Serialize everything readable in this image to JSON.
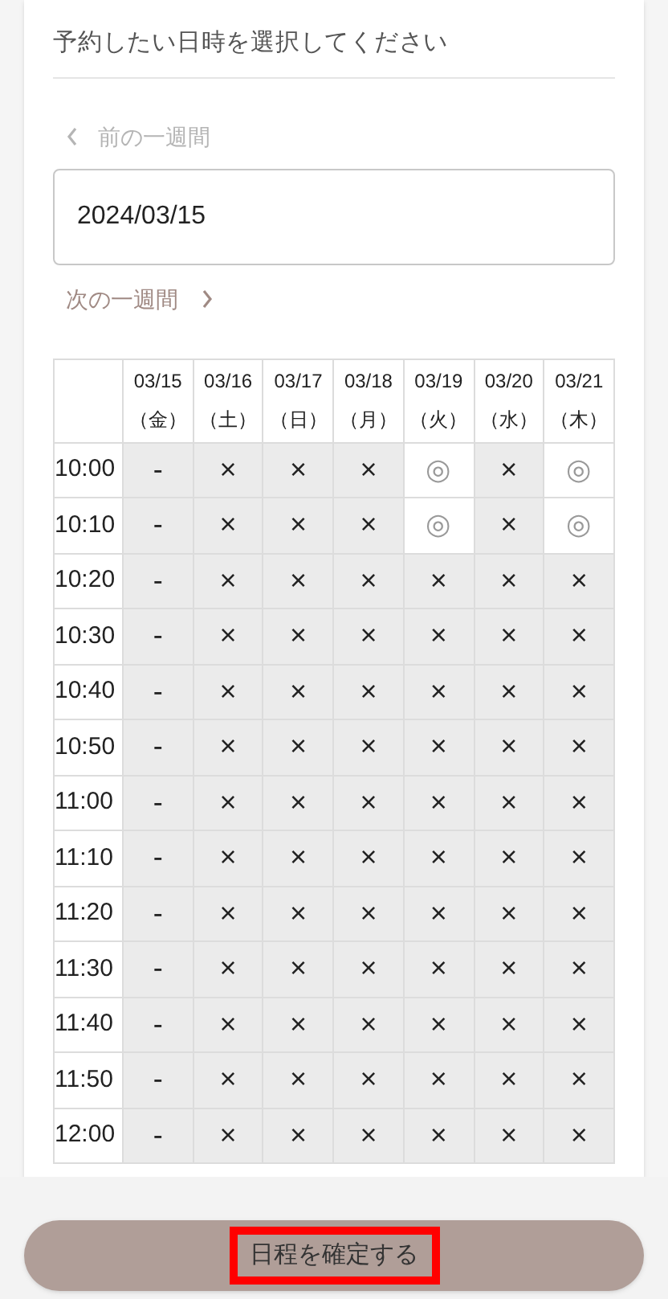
{
  "heading": "予約したい日時を選択してください",
  "prev_week": {
    "label": "前の一週間",
    "disabled": true
  },
  "date_field": {
    "value": "2024/03/15"
  },
  "next_week": {
    "label": "次の一週間",
    "disabled": false
  },
  "table": {
    "columns": [
      {
        "date": "03/15",
        "weekday": "（金）"
      },
      {
        "date": "03/16",
        "weekday": "（土）"
      },
      {
        "date": "03/17",
        "weekday": "（日）"
      },
      {
        "date": "03/18",
        "weekday": "（月）"
      },
      {
        "date": "03/19",
        "weekday": "（火）"
      },
      {
        "date": "03/20",
        "weekday": "（水）"
      },
      {
        "date": "03/21",
        "weekday": "（木）"
      }
    ],
    "rows": [
      {
        "time": "10:00",
        "cells": [
          {
            "kind": "none",
            "mark": "-"
          },
          {
            "kind": "full",
            "mark": "×"
          },
          {
            "kind": "full",
            "mark": "×"
          },
          {
            "kind": "full",
            "mark": "×"
          },
          {
            "kind": "open",
            "mark": "◎"
          },
          {
            "kind": "full",
            "mark": "×"
          },
          {
            "kind": "open",
            "mark": "◎"
          }
        ]
      },
      {
        "time": "10:10",
        "cells": [
          {
            "kind": "none",
            "mark": "-"
          },
          {
            "kind": "full",
            "mark": "×"
          },
          {
            "kind": "full",
            "mark": "×"
          },
          {
            "kind": "full",
            "mark": "×"
          },
          {
            "kind": "open",
            "mark": "◎"
          },
          {
            "kind": "full",
            "mark": "×"
          },
          {
            "kind": "open",
            "mark": "◎"
          }
        ]
      },
      {
        "time": "10:20",
        "cells": [
          {
            "kind": "none",
            "mark": "-"
          },
          {
            "kind": "full",
            "mark": "×"
          },
          {
            "kind": "full",
            "mark": "×"
          },
          {
            "kind": "full",
            "mark": "×"
          },
          {
            "kind": "full",
            "mark": "×"
          },
          {
            "kind": "full",
            "mark": "×"
          },
          {
            "kind": "full",
            "mark": "×"
          }
        ]
      },
      {
        "time": "10:30",
        "cells": [
          {
            "kind": "none",
            "mark": "-"
          },
          {
            "kind": "full",
            "mark": "×"
          },
          {
            "kind": "full",
            "mark": "×"
          },
          {
            "kind": "full",
            "mark": "×"
          },
          {
            "kind": "full",
            "mark": "×"
          },
          {
            "kind": "full",
            "mark": "×"
          },
          {
            "kind": "full",
            "mark": "×"
          }
        ]
      },
      {
        "time": "10:40",
        "cells": [
          {
            "kind": "none",
            "mark": "-"
          },
          {
            "kind": "full",
            "mark": "×"
          },
          {
            "kind": "full",
            "mark": "×"
          },
          {
            "kind": "full",
            "mark": "×"
          },
          {
            "kind": "full",
            "mark": "×"
          },
          {
            "kind": "full",
            "mark": "×"
          },
          {
            "kind": "full",
            "mark": "×"
          }
        ]
      },
      {
        "time": "10:50",
        "cells": [
          {
            "kind": "none",
            "mark": "-"
          },
          {
            "kind": "full",
            "mark": "×"
          },
          {
            "kind": "full",
            "mark": "×"
          },
          {
            "kind": "full",
            "mark": "×"
          },
          {
            "kind": "full",
            "mark": "×"
          },
          {
            "kind": "full",
            "mark": "×"
          },
          {
            "kind": "full",
            "mark": "×"
          }
        ]
      },
      {
        "time": "11:00",
        "cells": [
          {
            "kind": "none",
            "mark": "-"
          },
          {
            "kind": "full",
            "mark": "×"
          },
          {
            "kind": "full",
            "mark": "×"
          },
          {
            "kind": "full",
            "mark": "×"
          },
          {
            "kind": "full",
            "mark": "×"
          },
          {
            "kind": "full",
            "mark": "×"
          },
          {
            "kind": "full",
            "mark": "×"
          }
        ]
      },
      {
        "time": "11:10",
        "cells": [
          {
            "kind": "none",
            "mark": "-"
          },
          {
            "kind": "full",
            "mark": "×"
          },
          {
            "kind": "full",
            "mark": "×"
          },
          {
            "kind": "full",
            "mark": "×"
          },
          {
            "kind": "full",
            "mark": "×"
          },
          {
            "kind": "full",
            "mark": "×"
          },
          {
            "kind": "full",
            "mark": "×"
          }
        ]
      },
      {
        "time": "11:20",
        "cells": [
          {
            "kind": "none",
            "mark": "-"
          },
          {
            "kind": "full",
            "mark": "×"
          },
          {
            "kind": "full",
            "mark": "×"
          },
          {
            "kind": "full",
            "mark": "×"
          },
          {
            "kind": "full",
            "mark": "×"
          },
          {
            "kind": "full",
            "mark": "×"
          },
          {
            "kind": "full",
            "mark": "×"
          }
        ]
      },
      {
        "time": "11:30",
        "cells": [
          {
            "kind": "none",
            "mark": "-"
          },
          {
            "kind": "full",
            "mark": "×"
          },
          {
            "kind": "full",
            "mark": "×"
          },
          {
            "kind": "full",
            "mark": "×"
          },
          {
            "kind": "full",
            "mark": "×"
          },
          {
            "kind": "full",
            "mark": "×"
          },
          {
            "kind": "full",
            "mark": "×"
          }
        ]
      },
      {
        "time": "11:40",
        "cells": [
          {
            "kind": "none",
            "mark": "-"
          },
          {
            "kind": "full",
            "mark": "×"
          },
          {
            "kind": "full",
            "mark": "×"
          },
          {
            "kind": "full",
            "mark": "×"
          },
          {
            "kind": "full",
            "mark": "×"
          },
          {
            "kind": "full",
            "mark": "×"
          },
          {
            "kind": "full",
            "mark": "×"
          }
        ]
      },
      {
        "time": "11:50",
        "cells": [
          {
            "kind": "none",
            "mark": "-"
          },
          {
            "kind": "full",
            "mark": "×"
          },
          {
            "kind": "full",
            "mark": "×"
          },
          {
            "kind": "full",
            "mark": "×"
          },
          {
            "kind": "full",
            "mark": "×"
          },
          {
            "kind": "full",
            "mark": "×"
          },
          {
            "kind": "full",
            "mark": "×"
          }
        ]
      },
      {
        "time": "12:00",
        "cells": [
          {
            "kind": "none",
            "mark": "-"
          },
          {
            "kind": "full",
            "mark": "×"
          },
          {
            "kind": "full",
            "mark": "×"
          },
          {
            "kind": "full",
            "mark": "×"
          },
          {
            "kind": "full",
            "mark": "×"
          },
          {
            "kind": "full",
            "mark": "×"
          },
          {
            "kind": "full",
            "mark": "×"
          }
        ]
      }
    ]
  },
  "confirm_button": {
    "label": "日程を確定する",
    "highlighted": true
  }
}
